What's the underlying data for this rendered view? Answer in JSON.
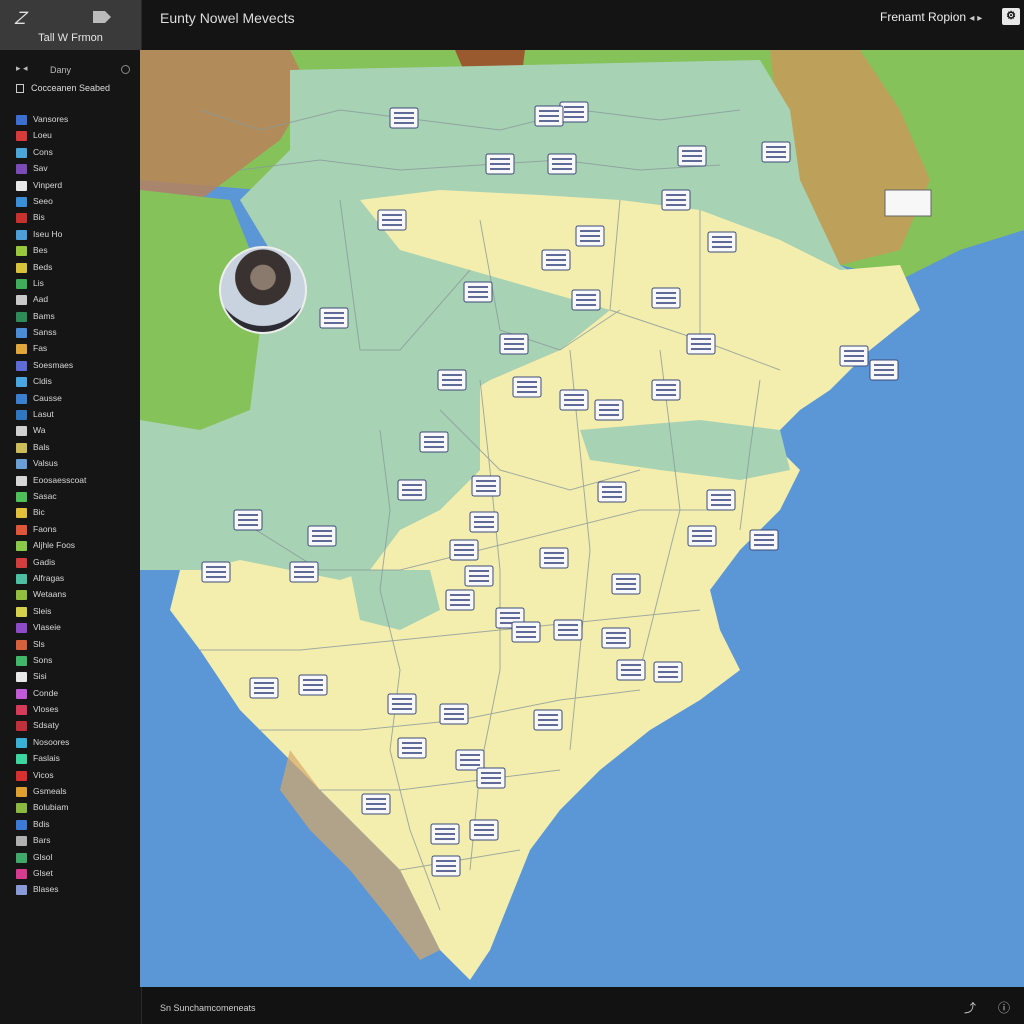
{
  "app": {
    "name": "Tall W Frmon",
    "logo_glyph": "Z",
    "map_title": "Eunty Nowel Mevects",
    "region_label": "Frenamt Ropion",
    "settings_glyph": "⚙",
    "status_text": "Sn Sunchamcomeneats"
  },
  "sidebar": {
    "filter_label": "Dany",
    "section_label": "Cocceanen Seabed",
    "layers": [
      {
        "label": "Vansores",
        "color": "#3d6fd1"
      },
      {
        "label": "Loeu",
        "color": "#d63b3b"
      },
      {
        "label": "Cons",
        "color": "#4aa5d8"
      },
      {
        "label": "Sav",
        "color": "#7b4bb8"
      },
      {
        "label": "Vinperd",
        "color": "#e8e8e8"
      },
      {
        "label": "Seeo",
        "color": "#3b8fd6"
      },
      {
        "label": "Bis",
        "color": "#c8322e"
      },
      {
        "label": "Iseu Ho",
        "color": "#4c9fd8"
      },
      {
        "label": "Bes",
        "color": "#9ac83c"
      },
      {
        "label": "Beds",
        "color": "#d6c23b"
      },
      {
        "label": "Lis",
        "color": "#3fae5a"
      },
      {
        "label": "Aad",
        "color": "#c9c9c9"
      },
      {
        "label": "Bams",
        "color": "#2e8b57"
      },
      {
        "label": "Sanss",
        "color": "#4a8cd6"
      },
      {
        "label": "Fas",
        "color": "#e0a53b"
      },
      {
        "label": "Soesmaes",
        "color": "#5f6bd6"
      },
      {
        "label": "Cldis",
        "color": "#49a6e0"
      },
      {
        "label": "Causse",
        "color": "#3c7fd0"
      },
      {
        "label": "Lasut",
        "color": "#2f78c0"
      },
      {
        "label": "Wa",
        "color": "#d0d0d0"
      },
      {
        "label": "Bals",
        "color": "#cdbd5a"
      },
      {
        "label": "Valsus",
        "color": "#6a9fd6"
      },
      {
        "label": "Eoosaesscoat",
        "color": "#d6d6d6"
      },
      {
        "label": "Sasac",
        "color": "#4fbf5a"
      },
      {
        "label": "Bic",
        "color": "#e2c03c"
      },
      {
        "label": "Faons",
        "color": "#e0563b"
      },
      {
        "label": "Aljhle Foos",
        "color": "#8ac94a"
      },
      {
        "label": "Gadis",
        "color": "#d33d3d"
      },
      {
        "label": "Alfragas",
        "color": "#4cc0a0"
      },
      {
        "label": "Wetaans",
        "color": "#8fbf3c"
      },
      {
        "label": "Sleis",
        "color": "#d6d14a"
      },
      {
        "label": "Vlaseie",
        "color": "#8e4bc8"
      },
      {
        "label": "Sls",
        "color": "#d6603b"
      },
      {
        "label": "Sons",
        "color": "#3fb86a"
      },
      {
        "label": "Sisi",
        "color": "#e8e8e8"
      },
      {
        "label": "Conde",
        "color": "#c25ad8"
      },
      {
        "label": "Vloses",
        "color": "#d63b5a"
      },
      {
        "label": "Sdsaty",
        "color": "#c0303a"
      },
      {
        "label": "Nosoores",
        "color": "#3bb0d6"
      },
      {
        "label": "Faslais",
        "color": "#3ed6a0"
      },
      {
        "label": "Vicos",
        "color": "#d63030"
      },
      {
        "label": "Gsmeals",
        "color": "#e0a030"
      },
      {
        "label": "Bolubiam",
        "color": "#8ab840"
      },
      {
        "label": "Bdis",
        "color": "#3b7ad6"
      },
      {
        "label": "Bars",
        "color": "#b0b0b0"
      },
      {
        "label": "Glsol",
        "color": "#3fa86a"
      },
      {
        "label": "Glset",
        "color": "#d63b8f"
      },
      {
        "label": "Blases",
        "color": "#8a9ad6"
      }
    ]
  },
  "map": {
    "colors": {
      "ocean": "#5b96d6",
      "land_yellow": "#f4eeae",
      "land_teal": "#a8d2b4",
      "land_green": "#86c25a",
      "terrain_brown": "#b8835a",
      "border": "#8a9a9a"
    }
  }
}
